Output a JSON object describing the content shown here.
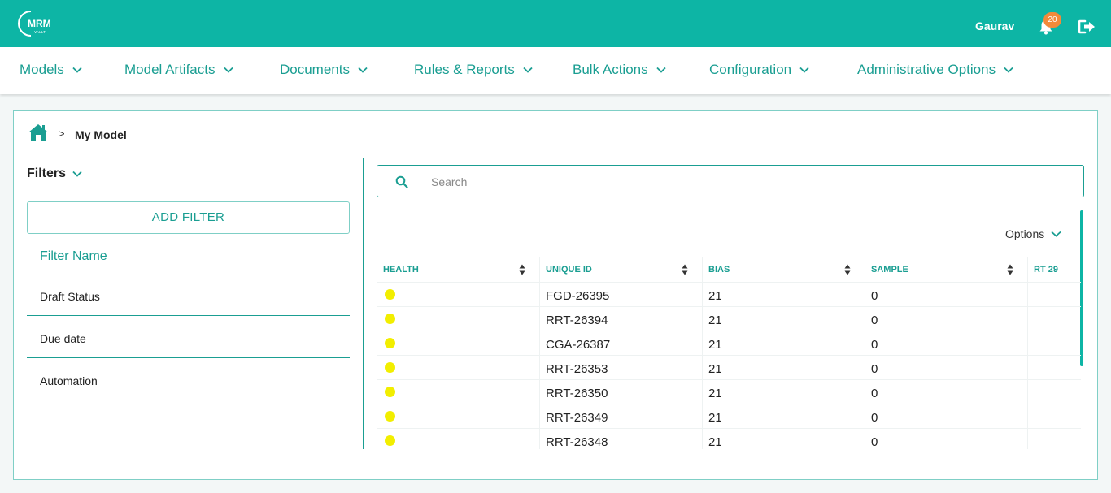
{
  "header": {
    "logo_text": "MRM",
    "logo_subtext": "VAULT",
    "user_name": "Gaurav",
    "notification_count": "20",
    "brand_color": "#0db5a5"
  },
  "nav": {
    "items": [
      {
        "label": "Models"
      },
      {
        "label": "Model Artifacts"
      },
      {
        "label": "Documents"
      },
      {
        "label": "Rules & Reports"
      },
      {
        "label": "Bulk Actions"
      },
      {
        "label": "Configuration"
      },
      {
        "label": "Administrative Options"
      }
    ]
  },
  "breadcrumb": {
    "separator": ">",
    "current": "My Model"
  },
  "filters": {
    "title": "Filters",
    "add_button": "ADD FILTER",
    "column_header": "Filter Name",
    "items": [
      {
        "label": "Draft Status"
      },
      {
        "label": "Due date"
      },
      {
        "label": "Automation"
      }
    ]
  },
  "search": {
    "placeholder": "Search",
    "value": ""
  },
  "table": {
    "options_label": "Options",
    "columns": [
      "HEALTH",
      "UNIQUE ID",
      "BIAS",
      "SAMPLE",
      "RT 29"
    ],
    "rows": [
      {
        "health": "yellow",
        "unique_id": "FGD-26395",
        "bias": "21",
        "sample": "0"
      },
      {
        "health": "yellow",
        "unique_id": "RRT-26394",
        "bias": "21",
        "sample": "0"
      },
      {
        "health": "yellow",
        "unique_id": "CGA-26387",
        "bias": "21",
        "sample": "0"
      },
      {
        "health": "yellow",
        "unique_id": "RRT-26353",
        "bias": "21",
        "sample": "0"
      },
      {
        "health": "yellow",
        "unique_id": "RRT-26350",
        "bias": "21",
        "sample": "0"
      },
      {
        "health": "yellow",
        "unique_id": "RRT-26349",
        "bias": "21",
        "sample": "0"
      },
      {
        "health": "yellow",
        "unique_id": "RRT-26348",
        "bias": "21",
        "sample": "0"
      }
    ]
  }
}
